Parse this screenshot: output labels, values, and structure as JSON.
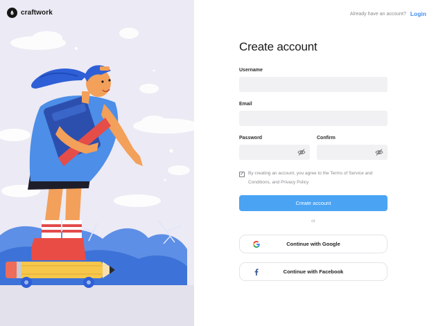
{
  "brand": {
    "name": "craftwork"
  },
  "header": {
    "prompt": "Already have an account?",
    "login_label": "Login"
  },
  "form": {
    "title": "Create account",
    "username": {
      "label": "Username",
      "value": "",
      "placeholder": ""
    },
    "email": {
      "label": "Email",
      "value": "",
      "placeholder": ""
    },
    "password": {
      "label": "Password",
      "value": "",
      "placeholder": ""
    },
    "confirm": {
      "label": "Confirm",
      "value": "",
      "placeholder": ""
    },
    "terms": {
      "checked": true,
      "text": "By creating an account, you agree to the Terms of Service and Conditions, and Privacy Policy"
    },
    "submit_label": "Create account",
    "divider": "or",
    "google_label": "Continue with Google",
    "facebook_label": "Continue with Facebook"
  },
  "icons": {
    "brand": "craftwork-logo-icon",
    "password_toggle": "eye-off-icon",
    "confirm_toggle": "eye-off-icon",
    "google": "google-icon",
    "facebook": "facebook-icon"
  },
  "colors": {
    "accent": "#4aa3f3",
    "link": "#3f8ef0",
    "input_bg": "#f1f1f3",
    "left_panel_bg": "#eceaf4"
  }
}
